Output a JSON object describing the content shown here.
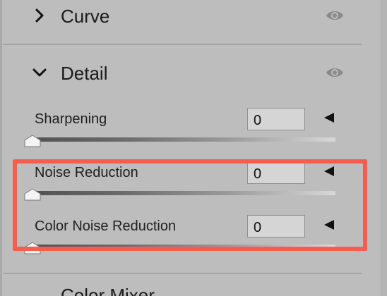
{
  "sections": {
    "curve": {
      "title": "Curve",
      "expanded": false
    },
    "detail": {
      "title": "Detail",
      "expanded": true
    },
    "next": {
      "title": "Color Mixer"
    }
  },
  "sliders": [
    {
      "label": "Sharpening",
      "value": "0"
    },
    {
      "label": "Noise Reduction",
      "value": "0"
    },
    {
      "label": "Color Noise Reduction",
      "value": "0"
    }
  ],
  "colors": {
    "panel_bg": "#bdbdbd",
    "highlight_border": "#f55d4e",
    "text": "#1c1c1c",
    "eye_icon": "#8a8a8a"
  },
  "icons": {
    "collapsed": "chevron-right-icon",
    "expanded": "chevron-down-icon",
    "visibility": "eye-icon",
    "reset": "triangle-left-icon",
    "slider_thumb": "slider-thumb-icon"
  }
}
